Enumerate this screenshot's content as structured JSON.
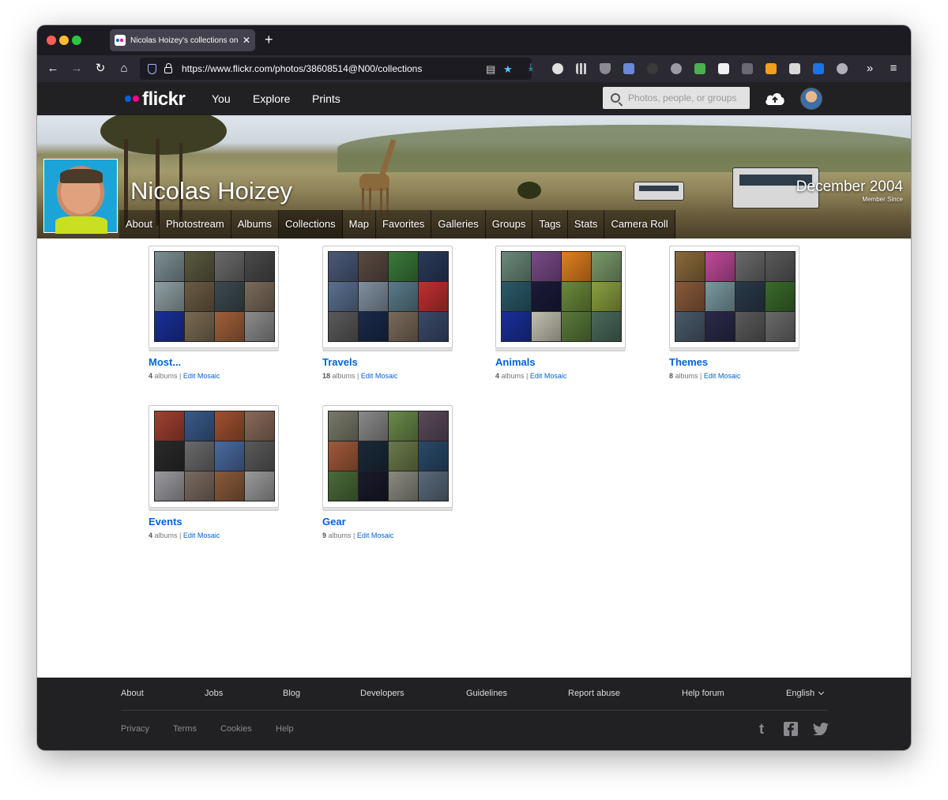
{
  "browser": {
    "tab_title": "Nicolas Hoizey's collections on Flickr",
    "tab_close": "✕",
    "new_tab": "+",
    "url": "https://www.flickr.com/photos/38608514@N00/collections"
  },
  "header": {
    "logo": "flickr",
    "nav": [
      "You",
      "Explore",
      "Prints"
    ],
    "search_placeholder": "Photos, people, or groups"
  },
  "profile": {
    "name": "Nicolas Hoizey",
    "member_since_date": "December 2004",
    "member_since_label": "Member Since",
    "tabs": [
      {
        "label": "About"
      },
      {
        "label": "Photostream"
      },
      {
        "label": "Albums"
      },
      {
        "label": "Collections"
      },
      {
        "label": "Map"
      },
      {
        "label": "Favorites"
      },
      {
        "label": "Galleries"
      },
      {
        "label": "Groups"
      },
      {
        "label": "Tags"
      },
      {
        "label": "Stats"
      },
      {
        "label": "Camera Roll"
      }
    ]
  },
  "collections": [
    {
      "title": "Most...",
      "count": "4",
      "unit": "albums",
      "edit": "Edit Mosaic",
      "tiles": [
        "#7d8f93",
        "#5b5a3f",
        "#6a6a6a",
        "#4a4a4a",
        "#8fa0a3",
        "#6b5b43",
        "#3c4a50",
        "#7a6a5a",
        "#1a2f9a",
        "#7a6a52",
        "#a0603a",
        "#8c8c8c"
      ]
    },
    {
      "title": "Travels",
      "count": "18",
      "unit": "albums",
      "edit": "Edit Mosaic",
      "tiles": [
        "#4b5a78",
        "#5a4a42",
        "#3a7a3a",
        "#2a3a5a",
        "#5a7090",
        "#8090a0",
        "#5a7a8a",
        "#c03030",
        "#5a5a5a",
        "#1a2a4a",
        "#7a6a5a",
        "#3a4a6a"
      ]
    },
    {
      "title": "Animals",
      "count": "4",
      "unit": "albums",
      "edit": "Edit Mosaic",
      "tiles": [
        "#6a8a7a",
        "#7a4a8a",
        "#e08020",
        "#7a9a6a",
        "#2a5a6a",
        "#1a1a3a",
        "#6a8a3a",
        "#8aa040",
        "#1a2f9a",
        "#c0c0b0",
        "#5a7a3a",
        "#4a6a5a"
      ]
    },
    {
      "title": "Themes",
      "count": "8",
      "unit": "albums",
      "edit": "Edit Mosaic",
      "tiles": [
        "#8a6a3a",
        "#c04a9a",
        "#6a6a6a",
        "#5a5a5a",
        "#8a5a3a",
        "#7a9aa0",
        "#2a3a4a",
        "#3a6a2a",
        "#4a5a6a",
        "#2a2a4a",
        "#5a5a5a",
        "#6a6a6a"
      ]
    },
    {
      "title": "Events",
      "count": "4",
      "unit": "albums",
      "edit": "Edit Mosaic",
      "tiles": [
        "#a04030",
        "#3a5a8a",
        "#a05030",
        "#8a6a5a",
        "#2a2a2a",
        "#6a6a6a",
        "#4a6aa0",
        "#5a5a5a",
        "#9a9aa0",
        "#7a6a60",
        "#8a5a3a",
        "#9a9a9a"
      ]
    },
    {
      "title": "Gear",
      "count": "9",
      "unit": "albums",
      "edit": "Edit Mosaic",
      "tiles": [
        "#7a7a6a",
        "#8a8a8a",
        "#6a8a4a",
        "#5a4a5a",
        "#a05a3a",
        "#1a2a3a",
        "#6a7a4a",
        "#2a4a6a",
        "#4a6a3a",
        "#1a1a2a",
        "#8a8a80",
        "#5a6a7a"
      ]
    }
  ],
  "footer": {
    "links": [
      "About",
      "Jobs",
      "Blog",
      "Developers",
      "Guidelines",
      "Report abuse",
      "Help forum"
    ],
    "language": "English",
    "sub_links": [
      "Privacy",
      "Terms",
      "Cookies",
      "Help"
    ]
  }
}
